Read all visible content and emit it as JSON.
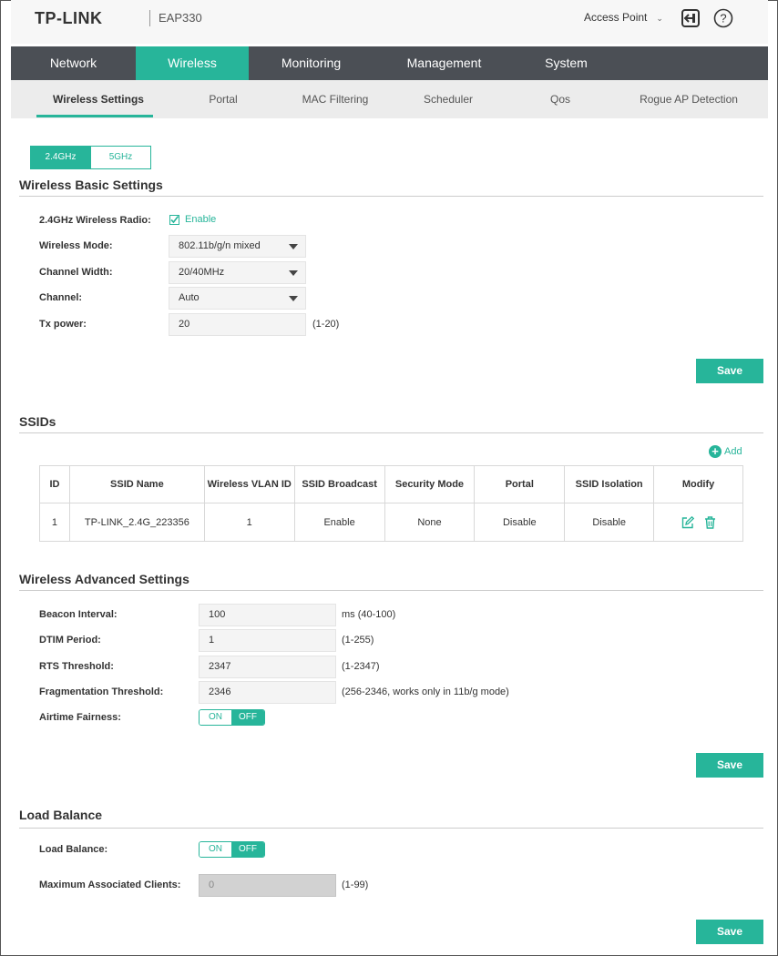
{
  "header": {
    "brand": "TP-LINK",
    "model": "EAP330",
    "mode": "Access Point"
  },
  "nav": {
    "tabs": [
      {
        "label": "Network",
        "active": false
      },
      {
        "label": "Wireless",
        "active": true
      },
      {
        "label": "Monitoring",
        "active": false
      },
      {
        "label": "Management",
        "active": false
      },
      {
        "label": "System",
        "active": false
      }
    ]
  },
  "subnav": {
    "tabs": [
      {
        "label": "Wireless Settings",
        "active": true
      },
      {
        "label": "Portal",
        "active": false
      },
      {
        "label": "MAC Filtering",
        "active": false
      },
      {
        "label": "Scheduler",
        "active": false
      },
      {
        "label": "Qos",
        "active": false
      },
      {
        "label": "Rogue AP Detection",
        "active": false
      }
    ]
  },
  "band": {
    "tab_24": "2.4GHz",
    "tab_5": "5GHz",
    "selected": "2.4GHz"
  },
  "basic": {
    "title": "Wireless Basic Settings",
    "radio_label": "2.4GHz Wireless Radio:",
    "radio_checkbox_label": "Enable",
    "radio_enabled": true,
    "mode_label": "Wireless Mode:",
    "mode_value": "802.11b/g/n mixed",
    "width_label": "Channel Width:",
    "width_value": "20/40MHz",
    "channel_label": "Channel:",
    "channel_value": "Auto",
    "tx_label": "Tx power:",
    "tx_value": "20",
    "tx_hint": "(1-20)",
    "save": "Save"
  },
  "ssids": {
    "title": "SSIDs",
    "add": "Add",
    "columns": [
      "ID",
      "SSID Name",
      "Wireless VLAN ID",
      "SSID Broadcast",
      "Security Mode",
      "Portal",
      "SSID Isolation",
      "Modify"
    ],
    "rows": [
      {
        "id": "1",
        "name": "TP-LINK_2.4G_223356",
        "vlan": "1",
        "broadcast": "Enable",
        "security": "None",
        "portal": "Disable",
        "isolation": "Disable"
      }
    ]
  },
  "advanced": {
    "title": "Wireless Advanced Settings",
    "beacon_label": "Beacon Interval:",
    "beacon_value": "100",
    "beacon_hint": "ms (40-100)",
    "dtim_label": "DTIM Period:",
    "dtim_value": "1",
    "dtim_hint": "(1-255)",
    "rts_label": "RTS Threshold:",
    "rts_value": "2347",
    "rts_hint": "(1-2347)",
    "frag_label": "Fragmentation Threshold:",
    "frag_value": "2346",
    "frag_hint": "(256-2346, works only in 11b/g mode)",
    "airtime_label": "Airtime Fairness:",
    "toggle_on": "ON",
    "toggle_off": "OFF",
    "airtime_state": "OFF",
    "save": "Save"
  },
  "load_balance": {
    "title": "Load Balance",
    "lb_label": "Load Balance:",
    "toggle_on": "ON",
    "toggle_off": "OFF",
    "lb_state": "OFF",
    "max_label": "Maximum Associated Clients:",
    "max_value": "0",
    "max_hint": "(1-99)",
    "save": "Save"
  },
  "colors": {
    "accent": "#27b59a",
    "nav_bg": "#4b4f55",
    "subnav_bg": "#ececec"
  }
}
